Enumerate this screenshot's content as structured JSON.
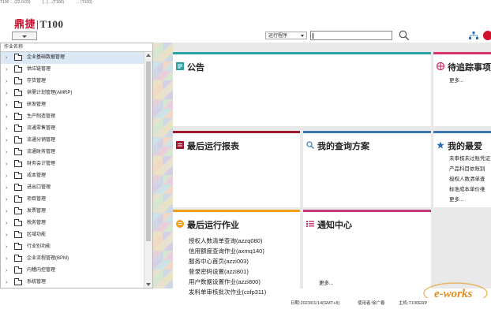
{
  "header": {
    "titlebar_items": [
      "T100 ... (22.0.03)",
      "[...] ...(T100)",
      "... (T100)"
    ],
    "logo_brand": "鼎捷",
    "logo_sep": "|",
    "logo_product": "T100",
    "search_scope": "运行程序",
    "search_value": "",
    "search_icon": "magnifier"
  },
  "left_panel": {
    "column_header": "作业名称",
    "items": [
      {
        "label": "企业基础数据管理",
        "selected": true
      },
      {
        "label": "供应链管理",
        "selected": false
      },
      {
        "label": "存货管理",
        "selected": false
      },
      {
        "label": "供需计划管理(AMRP)",
        "selected": false
      },
      {
        "label": "研发管理",
        "selected": false
      },
      {
        "label": "生产制造管理",
        "selected": false
      },
      {
        "label": "流通零售管理",
        "selected": false
      },
      {
        "label": "流通分销管理",
        "selected": false
      },
      {
        "label": "流通财务管理",
        "selected": false
      },
      {
        "label": "财务会计管理",
        "selected": false
      },
      {
        "label": "成本管理",
        "selected": false
      },
      {
        "label": "进出口管理",
        "selected": false
      },
      {
        "label": "项目管理",
        "selected": false
      },
      {
        "label": "发票管理",
        "selected": false
      },
      {
        "label": "税务管理",
        "selected": false
      },
      {
        "label": "区域功能",
        "selected": false
      },
      {
        "label": "行业别功能",
        "selected": false
      },
      {
        "label": "企业流程管理(BPM)",
        "selected": false
      },
      {
        "label": "内稽内控管理",
        "selected": false
      },
      {
        "label": "系统管理",
        "selected": false
      }
    ]
  },
  "cards": {
    "announcement": {
      "title": "公告"
    },
    "pending": {
      "title": "待追踪事项",
      "more": "更多..."
    },
    "reports": {
      "title": "最后运行报表"
    },
    "query": {
      "title": "我的查询方案"
    },
    "favorites": {
      "title": "我的最爱",
      "links": [
        "未审核未过账凭证",
        "产品科目依账别",
        "授权人数清单查",
        "标准成本单价维"
      ],
      "more": "更多..."
    },
    "last_jobs": {
      "title": "最后运行作业",
      "links": [
        "授权人数清单查询(azzq080)",
        "信用额度查询作业(axmq140)",
        "服务中心首页(azzi003)",
        "登录密码设置(azzi801)",
        "用户数据设置作业(azzi800)",
        "发料单审核批次作业(csfp311)"
      ]
    },
    "notify": {
      "title": "通知中心",
      "more": "更多..."
    }
  },
  "footer": {
    "date": "日期:2023/01/14(GMT+8)",
    "user": "使用者:徐广春",
    "host": "主机:T100ERP"
  },
  "colors": {
    "brand_red": "#c8102e",
    "teal": "#2aa4a0",
    "pink": "#d6336c",
    "dark_red": "#a0192e",
    "blue": "#3a78b5",
    "orange": "#f2a01c",
    "selected_row": "#dbe8f6"
  }
}
